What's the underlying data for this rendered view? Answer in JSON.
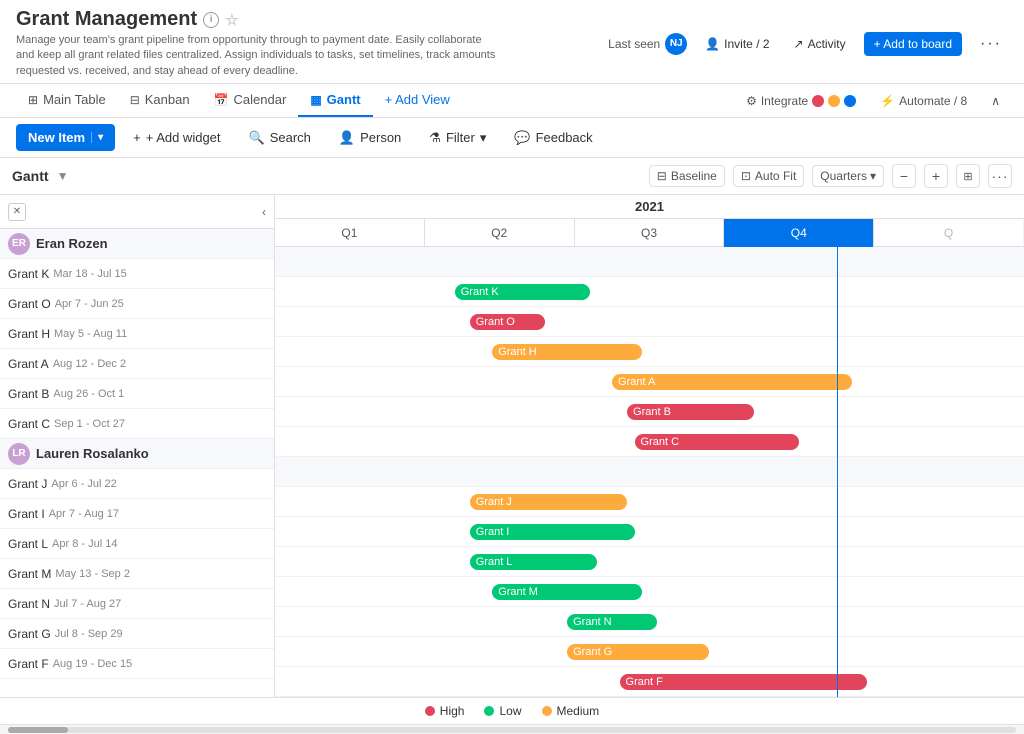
{
  "header": {
    "title": "Grant Management",
    "subtitle": "Manage your team's grant pipeline from opportunity through to payment date. Easily collaborate and keep all grant related files centralized. Assign individuals to tasks, set timelines, track amounts requested vs. received, and stay ahead of every deadline.",
    "last_seen_label": "Last seen",
    "invite_label": "Invite / 2",
    "activity_label": "Activity",
    "add_to_board_label": "+ Add to board",
    "more_label": "···"
  },
  "nav": {
    "tabs": [
      {
        "id": "main-table",
        "label": "Main Table",
        "icon": "table"
      },
      {
        "id": "kanban",
        "label": "Kanban",
        "icon": "kanban"
      },
      {
        "id": "calendar",
        "label": "Calendar",
        "icon": "calendar"
      },
      {
        "id": "gantt",
        "label": "Gantt",
        "icon": "gantt",
        "active": true
      },
      {
        "id": "add-view",
        "label": "+ Add View",
        "icon": "plus"
      }
    ],
    "integrate_label": "Integrate",
    "automate_label": "Automate / 8"
  },
  "toolbar": {
    "new_item_label": "New Item",
    "add_widget_label": "+ Add widget",
    "search_label": "Search",
    "person_label": "Person",
    "filter_label": "Filter",
    "feedback_label": "Feedback"
  },
  "gantt": {
    "title": "Gantt",
    "baseline_label": "Baseline",
    "auto_fit_label": "Auto Fit",
    "quarters_label": "Quarters",
    "year": "2021",
    "quarters": [
      "Q1",
      "Q2",
      "Q3",
      "Q4"
    ],
    "today_line_q4": true,
    "people": [
      {
        "name": "Eran Rozen",
        "avatar_text": "ER",
        "avatar_color": "#c8a0d4",
        "grants": [
          {
            "name": "Grant K",
            "date": "Mar 18 - Jul 15",
            "color": "green",
            "left_pct": 24,
            "width_pct": 18,
            "label": "Grant K"
          },
          {
            "name": "Grant O",
            "date": "Apr 7 - Jun 25",
            "color": "red",
            "left_pct": 26,
            "width_pct": 12,
            "label": "Grant O"
          },
          {
            "name": "Grant H",
            "date": "May 5 - Aug 11",
            "color": "orange",
            "left_pct": 29,
            "width_pct": 18,
            "label": "Grant H"
          },
          {
            "name": "Grant A",
            "date": "Aug 12 - Dec 2",
            "color": "orange",
            "left_pct": 45,
            "width_pct": 24,
            "label": "Grant A"
          },
          {
            "name": "Grant B",
            "date": "Aug 26 - Oct 1",
            "color": "red",
            "left_pct": 47,
            "width_pct": 14,
            "label": "Grant B"
          },
          {
            "name": "Grant C",
            "date": "Sep 1 - Oct 27",
            "color": "red",
            "left_pct": 48,
            "width_pct": 17,
            "label": "Grant C"
          }
        ]
      },
      {
        "name": "Lauren Rosalanko",
        "avatar_text": "LR",
        "avatar_color": "#c8a0d4",
        "grants": [
          {
            "name": "Grant J",
            "date": "Apr 6 - Jul 22",
            "color": "orange",
            "left_pct": 26,
            "width_pct": 18,
            "label": "Grant J"
          },
          {
            "name": "Grant I",
            "date": "Apr 7 - Aug 17",
            "color": "green",
            "left_pct": 26,
            "width_pct": 20,
            "label": "Grant I"
          },
          {
            "name": "Grant L",
            "date": "Apr 8 - Jul 14",
            "color": "green",
            "left_pct": 26,
            "width_pct": 16,
            "label": "Grant L"
          },
          {
            "name": "Grant M",
            "date": "May 13 - Sep 2",
            "color": "green",
            "left_pct": 29,
            "width_pct": 19,
            "label": "Grant M"
          },
          {
            "name": "Grant N",
            "date": "Jul 7 - Aug 27",
            "color": "green",
            "left_pct": 39,
            "width_pct": 12,
            "label": "Grant N"
          },
          {
            "name": "Grant G",
            "date": "Jul 8 - Sep 29",
            "color": "orange",
            "left_pct": 39,
            "width_pct": 18,
            "label": "Grant G"
          },
          {
            "name": "Grant F",
            "date": "Aug 19 - Dec 15",
            "color": "red",
            "left_pct": 46,
            "width_pct": 28,
            "label": "Grant F"
          }
        ]
      }
    ],
    "legend": [
      {
        "label": "High",
        "color": "#e2445c"
      },
      {
        "label": "Low",
        "color": "#00c875"
      },
      {
        "label": "Medium",
        "color": "#fdab3d"
      }
    ]
  }
}
